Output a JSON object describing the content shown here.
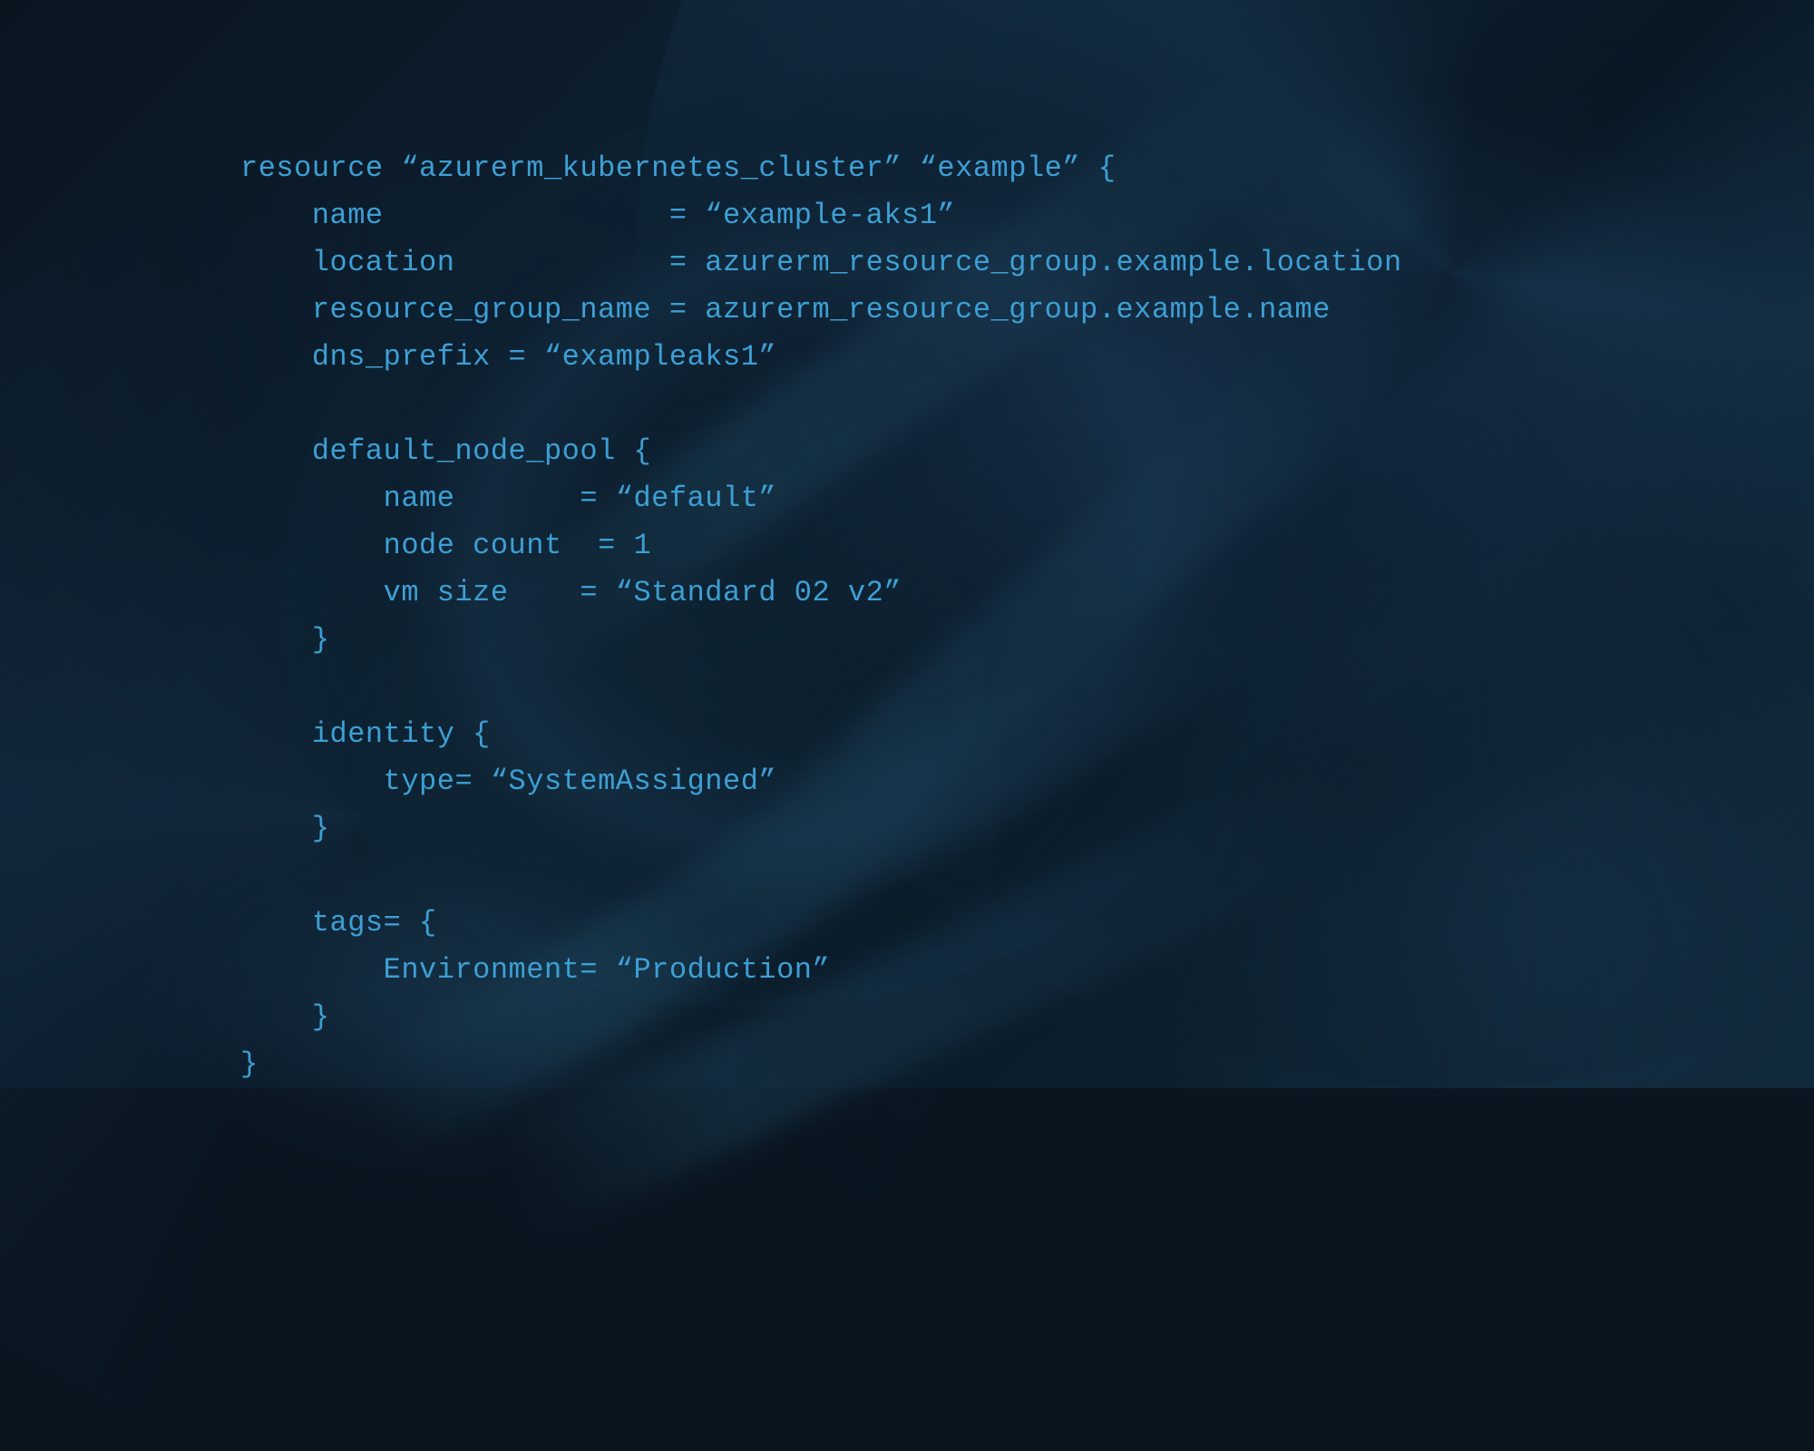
{
  "code": {
    "lines": [
      "resource “azurerm_kubernetes_cluster” “example” {",
      "    name                = “example-aks1”",
      "    location            = azurerm_resource_group.example.location",
      "    resource_group_name = azurerm_resource_group.example.name",
      "    dns_prefix = “exampleaks1”",
      "",
      "    default_node_pool {",
      "        name       = “default”",
      "        node count  = 1",
      "        vm size    = “Standard 02 v2”",
      "    }",
      "",
      "    identity {",
      "        type= “SystemAssigned”",
      "    }",
      "",
      "    tags= {",
      "        Environment= “Production”",
      "    }",
      "}"
    ]
  }
}
